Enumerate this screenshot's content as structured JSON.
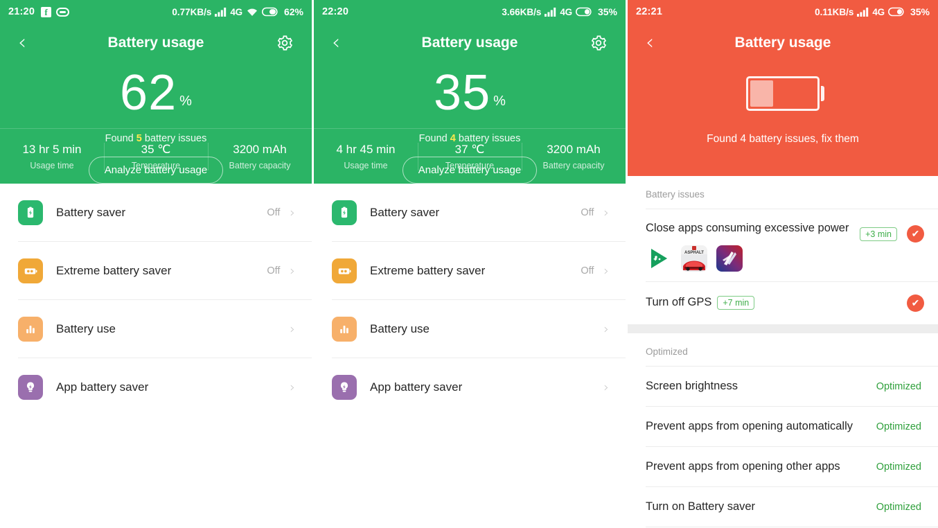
{
  "colors": {
    "green": "#2bb465",
    "orange": "#f15b41",
    "highlight_yellow": "#ffe94d",
    "optimized_green": "#2fa03c"
  },
  "panel1": {
    "statusbar": {
      "time": "21:20",
      "left_icons": [
        "facebook-icon",
        "messenger-icon"
      ],
      "network_speed": "0.77KB/s",
      "signal": "signal-bars-icon",
      "network_type": "4G",
      "wifi": "wifi-icon",
      "battery_icon": "battery-icon",
      "battery_percent": "62%"
    },
    "navbar": {
      "back": "‹",
      "title": "Battery usage",
      "gear": "gear-icon"
    },
    "battery": {
      "value": "62",
      "sign": "%"
    },
    "found": {
      "prefix": "Found ",
      "count": "5",
      "suffix": " battery issues"
    },
    "analyze_label": "Analyze battery usage",
    "stats": [
      {
        "value": "13 hr 5 min",
        "label": "Usage time"
      },
      {
        "value": "35 ℃",
        "label": "Temperature"
      },
      {
        "value": "3200 mAh",
        "label": "Battery capacity"
      }
    ],
    "rows": [
      {
        "icon": "battery-saver-icon",
        "label": "Battery saver",
        "value": "Off",
        "chevron": "›"
      },
      {
        "icon": "extreme-battery-saver-icon",
        "label": "Extreme battery saver",
        "value": "Off",
        "chevron": "›"
      },
      {
        "icon": "battery-use-icon",
        "label": "Battery use",
        "value": "",
        "chevron": "›"
      },
      {
        "icon": "app-battery-saver-icon",
        "label": "App battery saver",
        "value": "",
        "chevron": "›"
      }
    ]
  },
  "panel2": {
    "statusbar": {
      "time": "22:20",
      "left_icons": [],
      "network_speed": "3.66KB/s",
      "signal": "signal-bars-icon",
      "network_type": "4G",
      "wifi": "",
      "battery_icon": "battery-icon",
      "battery_percent": "35%"
    },
    "navbar": {
      "back": "‹",
      "title": "Battery usage",
      "gear": "gear-icon"
    },
    "battery": {
      "value": "35",
      "sign": "%"
    },
    "found": {
      "prefix": "Found ",
      "count": "4",
      "suffix": " battery issues"
    },
    "analyze_label": "Analyze battery usage",
    "stats": [
      {
        "value": "4 hr 45 min",
        "label": "Usage time"
      },
      {
        "value": "37 ℃",
        "label": "Temperature"
      },
      {
        "value": "3200 mAh",
        "label": "Battery capacity"
      }
    ],
    "rows": [
      {
        "icon": "battery-saver-icon",
        "label": "Battery saver",
        "value": "Off",
        "chevron": "›"
      },
      {
        "icon": "extreme-battery-saver-icon",
        "label": "Extreme battery saver",
        "value": "Off",
        "chevron": "›"
      },
      {
        "icon": "battery-use-icon",
        "label": "Battery use",
        "value": "",
        "chevron": "›"
      },
      {
        "icon": "app-battery-saver-icon",
        "label": "App battery saver",
        "value": "",
        "chevron": "›"
      }
    ]
  },
  "panel3": {
    "statusbar": {
      "time": "22:21",
      "left_icons": [],
      "network_speed": "0.11KB/s",
      "signal": "signal-bars-icon",
      "network_type": "4G",
      "wifi": "",
      "battery_icon": "battery-icon",
      "battery_percent": "35%"
    },
    "navbar": {
      "back": "‹",
      "title": "Battery usage",
      "gear": ""
    },
    "battery_fill_percent": 35,
    "found_text": "Found 4 battery issues, fix them",
    "issues_section_title": "Battery issues",
    "issues": [
      {
        "title": "Close apps consuming excessive power",
        "badge": "+3 min",
        "check": "check-icon",
        "apps": [
          "google-play-games-icon",
          "asphalt-game-icon",
          "action-game-icon"
        ]
      },
      {
        "title": "Turn off GPS",
        "badge": "+7 min",
        "check": "check-icon",
        "apps": []
      }
    ],
    "optimized_section_title": "Optimized",
    "optimized": [
      {
        "label": "Screen brightness",
        "status": "Optimized"
      },
      {
        "label": "Prevent apps from opening automatically",
        "status": "Optimized"
      },
      {
        "label": "Prevent apps from opening other apps",
        "status": "Optimized"
      },
      {
        "label": "Turn on Battery saver",
        "status": "Optimized"
      }
    ]
  }
}
